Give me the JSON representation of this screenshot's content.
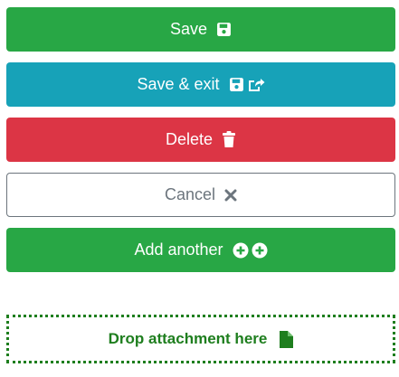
{
  "buttons": {
    "save": {
      "label": "Save",
      "icon": "floppy-disk-icon",
      "color": "#28a745"
    },
    "save_exit": {
      "label": "Save & exit",
      "icons": [
        "floppy-disk-icon",
        "share-external-icon"
      ],
      "color": "#17a2b8"
    },
    "delete": {
      "label": "Delete",
      "icon": "trash-icon",
      "color": "#dc3545"
    },
    "cancel": {
      "label": "Cancel",
      "icon": "close-icon",
      "color": "#6c757d"
    },
    "add_another": {
      "label": "Add another",
      "icons": [
        "plus-circle-icon",
        "plus-circle-icon"
      ],
      "color": "#28a745"
    }
  },
  "dropzone": {
    "label": "Drop attachment here",
    "icon": "file-icon",
    "color": "#1e7e1e"
  }
}
